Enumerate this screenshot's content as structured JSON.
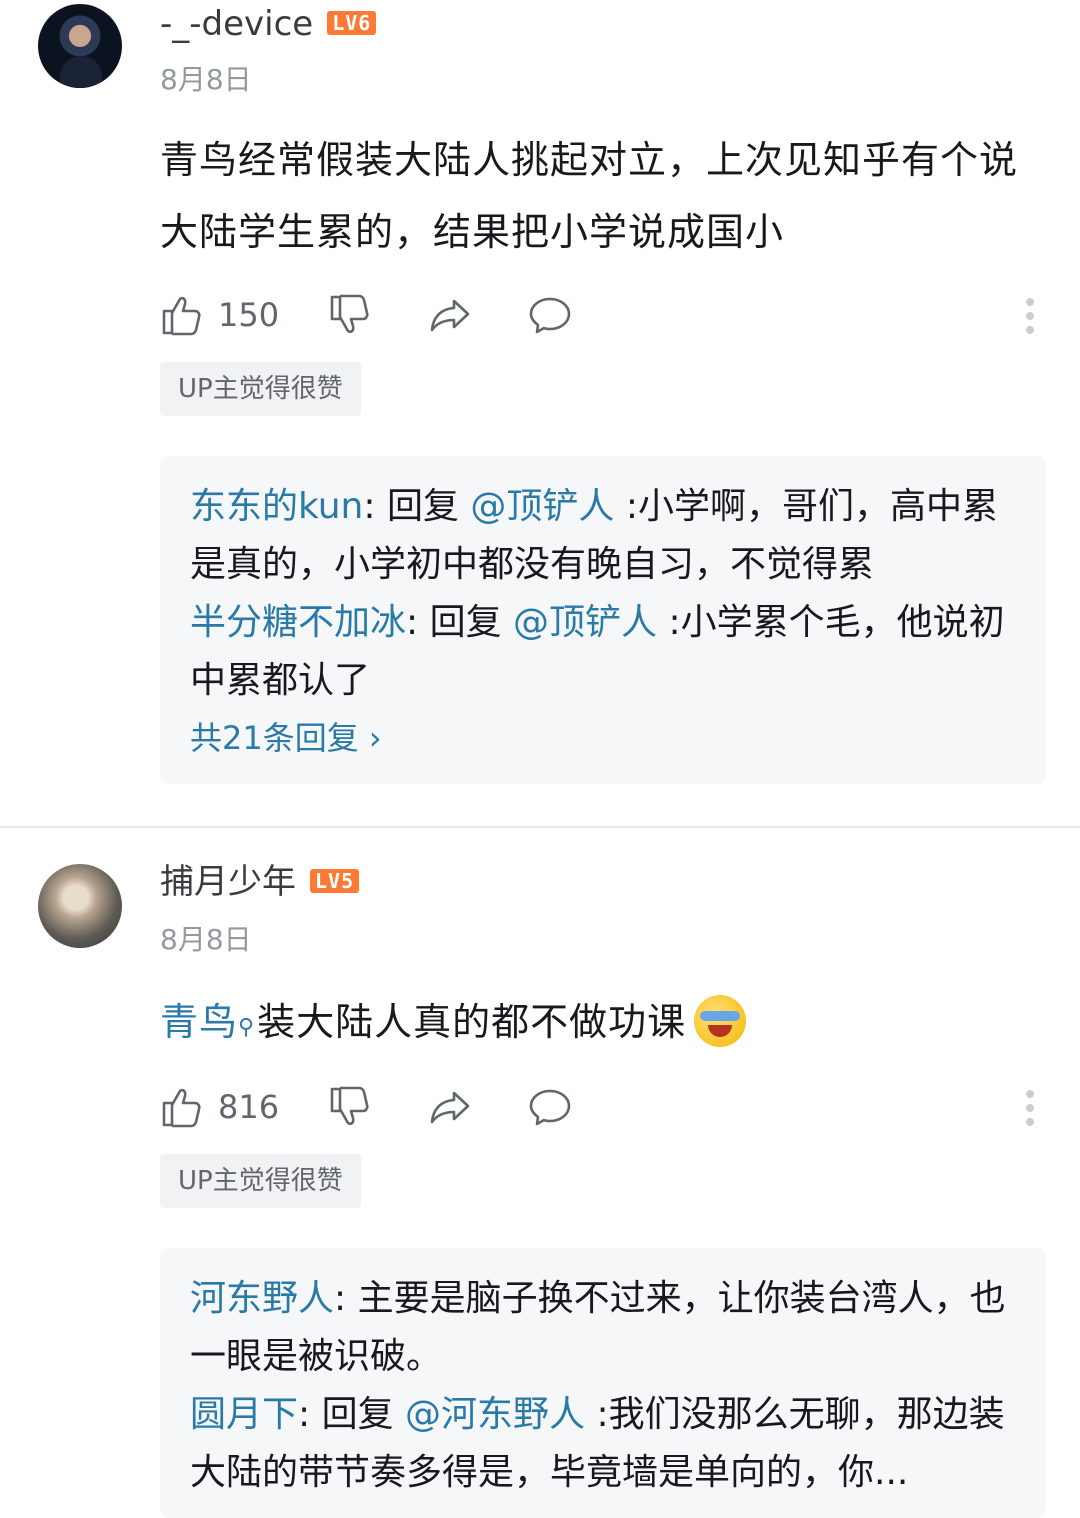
{
  "comments": [
    {
      "username": "-_-device",
      "level": "LV6",
      "date": "8月8日",
      "text": "青鸟经常假装大陆人挑起对立，上次见知乎有个说大陆学生累的，结果把小学说成国小",
      "likes": "150",
      "badge": "UP主觉得很赞",
      "replies": [
        {
          "name": "东东的kun",
          "sep": ": 回复 ",
          "at": "@顶铲人",
          "text": " :小学啊，哥们，高中累是真的，小学初中都没有晚自习，不觉得累"
        },
        {
          "name": "半分糖不加冰",
          "sep": ": 回复 ",
          "at": "@顶铲人",
          "text": " :小学累个毛，他说初中累都认了"
        }
      ],
      "more_replies": "共21条回复 ›"
    },
    {
      "username": "捕月少年",
      "level": "LV5",
      "date": "8月8日",
      "text_highlight": "青鸟",
      "text_rest": "装大陆人真的都不做功课",
      "likes": "816",
      "badge": "UP主觉得很赞",
      "replies": [
        {
          "name": "河东野人",
          "sep": ": ",
          "at": "",
          "text": "主要是脑子换不过来，让你装台湾人，也一眼是被识破。"
        },
        {
          "name": "圆月下",
          "sep": ": 回复 ",
          "at": "@河东野人",
          "text": " :我们没那么无聊，那边装大陆的带节奏多得是，毕竟墙是单向的，你..."
        }
      ]
    }
  ],
  "icons": {
    "like": "thumbs-up-icon",
    "dislike": "thumbs-down-icon",
    "share": "share-icon",
    "reply": "comment-bubble-icon",
    "more": "more-vertical-icon",
    "search": "search-icon",
    "emoji": "laughing-crying-emoji-icon"
  },
  "colors": {
    "link": "#2a7aa8",
    "level_badge": "#fb7a36",
    "reply_bg": "#f6f7f8"
  }
}
